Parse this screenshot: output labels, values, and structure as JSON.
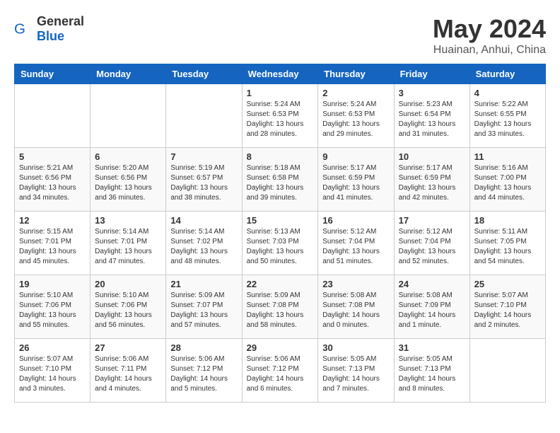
{
  "header": {
    "logo_general": "General",
    "logo_blue": "Blue",
    "month": "May 2024",
    "location": "Huainan, Anhui, China"
  },
  "weekdays": [
    "Sunday",
    "Monday",
    "Tuesday",
    "Wednesday",
    "Thursday",
    "Friday",
    "Saturday"
  ],
  "weeks": [
    [
      {
        "day": "",
        "sunrise": "",
        "sunset": "",
        "daylight": ""
      },
      {
        "day": "",
        "sunrise": "",
        "sunset": "",
        "daylight": ""
      },
      {
        "day": "",
        "sunrise": "",
        "sunset": "",
        "daylight": ""
      },
      {
        "day": "1",
        "sunrise": "Sunrise: 5:24 AM",
        "sunset": "Sunset: 6:53 PM",
        "daylight": "Daylight: 13 hours and 28 minutes."
      },
      {
        "day": "2",
        "sunrise": "Sunrise: 5:24 AM",
        "sunset": "Sunset: 6:53 PM",
        "daylight": "Daylight: 13 hours and 29 minutes."
      },
      {
        "day": "3",
        "sunrise": "Sunrise: 5:23 AM",
        "sunset": "Sunset: 6:54 PM",
        "daylight": "Daylight: 13 hours and 31 minutes."
      },
      {
        "day": "4",
        "sunrise": "Sunrise: 5:22 AM",
        "sunset": "Sunset: 6:55 PM",
        "daylight": "Daylight: 13 hours and 33 minutes."
      }
    ],
    [
      {
        "day": "5",
        "sunrise": "Sunrise: 5:21 AM",
        "sunset": "Sunset: 6:56 PM",
        "daylight": "Daylight: 13 hours and 34 minutes."
      },
      {
        "day": "6",
        "sunrise": "Sunrise: 5:20 AM",
        "sunset": "Sunset: 6:56 PM",
        "daylight": "Daylight: 13 hours and 36 minutes."
      },
      {
        "day": "7",
        "sunrise": "Sunrise: 5:19 AM",
        "sunset": "Sunset: 6:57 PM",
        "daylight": "Daylight: 13 hours and 38 minutes."
      },
      {
        "day": "8",
        "sunrise": "Sunrise: 5:18 AM",
        "sunset": "Sunset: 6:58 PM",
        "daylight": "Daylight: 13 hours and 39 minutes."
      },
      {
        "day": "9",
        "sunrise": "Sunrise: 5:17 AM",
        "sunset": "Sunset: 6:59 PM",
        "daylight": "Daylight: 13 hours and 41 minutes."
      },
      {
        "day": "10",
        "sunrise": "Sunrise: 5:17 AM",
        "sunset": "Sunset: 6:59 PM",
        "daylight": "Daylight: 13 hours and 42 minutes."
      },
      {
        "day": "11",
        "sunrise": "Sunrise: 5:16 AM",
        "sunset": "Sunset: 7:00 PM",
        "daylight": "Daylight: 13 hours and 44 minutes."
      }
    ],
    [
      {
        "day": "12",
        "sunrise": "Sunrise: 5:15 AM",
        "sunset": "Sunset: 7:01 PM",
        "daylight": "Daylight: 13 hours and 45 minutes."
      },
      {
        "day": "13",
        "sunrise": "Sunrise: 5:14 AM",
        "sunset": "Sunset: 7:01 PM",
        "daylight": "Daylight: 13 hours and 47 minutes."
      },
      {
        "day": "14",
        "sunrise": "Sunrise: 5:14 AM",
        "sunset": "Sunset: 7:02 PM",
        "daylight": "Daylight: 13 hours and 48 minutes."
      },
      {
        "day": "15",
        "sunrise": "Sunrise: 5:13 AM",
        "sunset": "Sunset: 7:03 PM",
        "daylight": "Daylight: 13 hours and 50 minutes."
      },
      {
        "day": "16",
        "sunrise": "Sunrise: 5:12 AM",
        "sunset": "Sunset: 7:04 PM",
        "daylight": "Daylight: 13 hours and 51 minutes."
      },
      {
        "day": "17",
        "sunrise": "Sunrise: 5:12 AM",
        "sunset": "Sunset: 7:04 PM",
        "daylight": "Daylight: 13 hours and 52 minutes."
      },
      {
        "day": "18",
        "sunrise": "Sunrise: 5:11 AM",
        "sunset": "Sunset: 7:05 PM",
        "daylight": "Daylight: 13 hours and 54 minutes."
      }
    ],
    [
      {
        "day": "19",
        "sunrise": "Sunrise: 5:10 AM",
        "sunset": "Sunset: 7:06 PM",
        "daylight": "Daylight: 13 hours and 55 minutes."
      },
      {
        "day": "20",
        "sunrise": "Sunrise: 5:10 AM",
        "sunset": "Sunset: 7:06 PM",
        "daylight": "Daylight: 13 hours and 56 minutes."
      },
      {
        "day": "21",
        "sunrise": "Sunrise: 5:09 AM",
        "sunset": "Sunset: 7:07 PM",
        "daylight": "Daylight: 13 hours and 57 minutes."
      },
      {
        "day": "22",
        "sunrise": "Sunrise: 5:09 AM",
        "sunset": "Sunset: 7:08 PM",
        "daylight": "Daylight: 13 hours and 58 minutes."
      },
      {
        "day": "23",
        "sunrise": "Sunrise: 5:08 AM",
        "sunset": "Sunset: 7:08 PM",
        "daylight": "Daylight: 14 hours and 0 minutes."
      },
      {
        "day": "24",
        "sunrise": "Sunrise: 5:08 AM",
        "sunset": "Sunset: 7:09 PM",
        "daylight": "Daylight: 14 hours and 1 minute."
      },
      {
        "day": "25",
        "sunrise": "Sunrise: 5:07 AM",
        "sunset": "Sunset: 7:10 PM",
        "daylight": "Daylight: 14 hours and 2 minutes."
      }
    ],
    [
      {
        "day": "26",
        "sunrise": "Sunrise: 5:07 AM",
        "sunset": "Sunset: 7:10 PM",
        "daylight": "Daylight: 14 hours and 3 minutes."
      },
      {
        "day": "27",
        "sunrise": "Sunrise: 5:06 AM",
        "sunset": "Sunset: 7:11 PM",
        "daylight": "Daylight: 14 hours and 4 minutes."
      },
      {
        "day": "28",
        "sunrise": "Sunrise: 5:06 AM",
        "sunset": "Sunset: 7:12 PM",
        "daylight": "Daylight: 14 hours and 5 minutes."
      },
      {
        "day": "29",
        "sunrise": "Sunrise: 5:06 AM",
        "sunset": "Sunset: 7:12 PM",
        "daylight": "Daylight: 14 hours and 6 minutes."
      },
      {
        "day": "30",
        "sunrise": "Sunrise: 5:05 AM",
        "sunset": "Sunset: 7:13 PM",
        "daylight": "Daylight: 14 hours and 7 minutes."
      },
      {
        "day": "31",
        "sunrise": "Sunrise: 5:05 AM",
        "sunset": "Sunset: 7:13 PM",
        "daylight": "Daylight: 14 hours and 8 minutes."
      },
      {
        "day": "",
        "sunrise": "",
        "sunset": "",
        "daylight": ""
      }
    ]
  ]
}
